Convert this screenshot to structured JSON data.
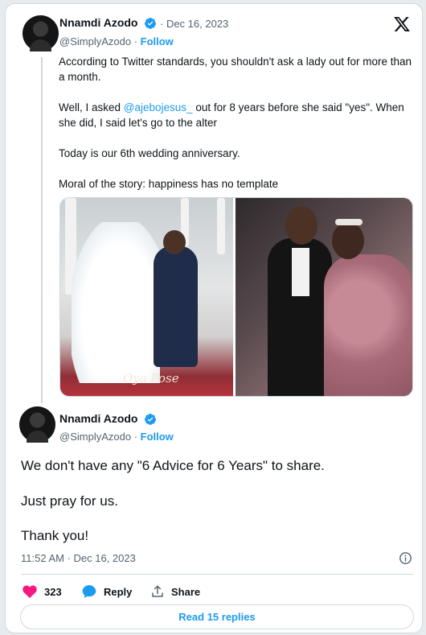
{
  "tweet1": {
    "author_name": "Nnamdi Azodo",
    "date": "· Dec 16, 2023",
    "handle": "@SimplyAzodo",
    "separator": " · ",
    "follow_label": "Follow",
    "para1": "According to Twitter standards, you shouldn't ask a lady out for more than a month.",
    "para2_before": "Well, I asked ",
    "para2_mention": "@ajebojesus_",
    "para2_after": " out for 8 years before she said \"yes\". When she did, I said let's go to the alter",
    "para3": "Today is our 6th wedding anniversary.",
    "para4": "Moral of the story: happiness has no template",
    "photo_watermark": "Oya Pose"
  },
  "tweet2": {
    "author_name": "Nnamdi Azodo",
    "handle": "@SimplyAzodo",
    "separator": " · ",
    "follow_label": "Follow",
    "line1": "We don't have any \"6 Advice for 6 Years\" to share.",
    "line2": "Just pray for us.",
    "line3": "Thank you!",
    "timestamp": "11:52 AM · Dec 16, 2023"
  },
  "actions": {
    "like_count": "323",
    "reply_label": "Reply",
    "share_label": "Share"
  },
  "read_replies_label": "Read 15 replies",
  "colors": {
    "accent": "#1d9bf0",
    "like": "#f91880",
    "text": "#0f1419",
    "muted": "#536471"
  },
  "icons": [
    "x-logo-icon",
    "verified-badge-icon",
    "heart-icon",
    "reply-bubble-icon",
    "share-icon",
    "info-icon"
  ]
}
